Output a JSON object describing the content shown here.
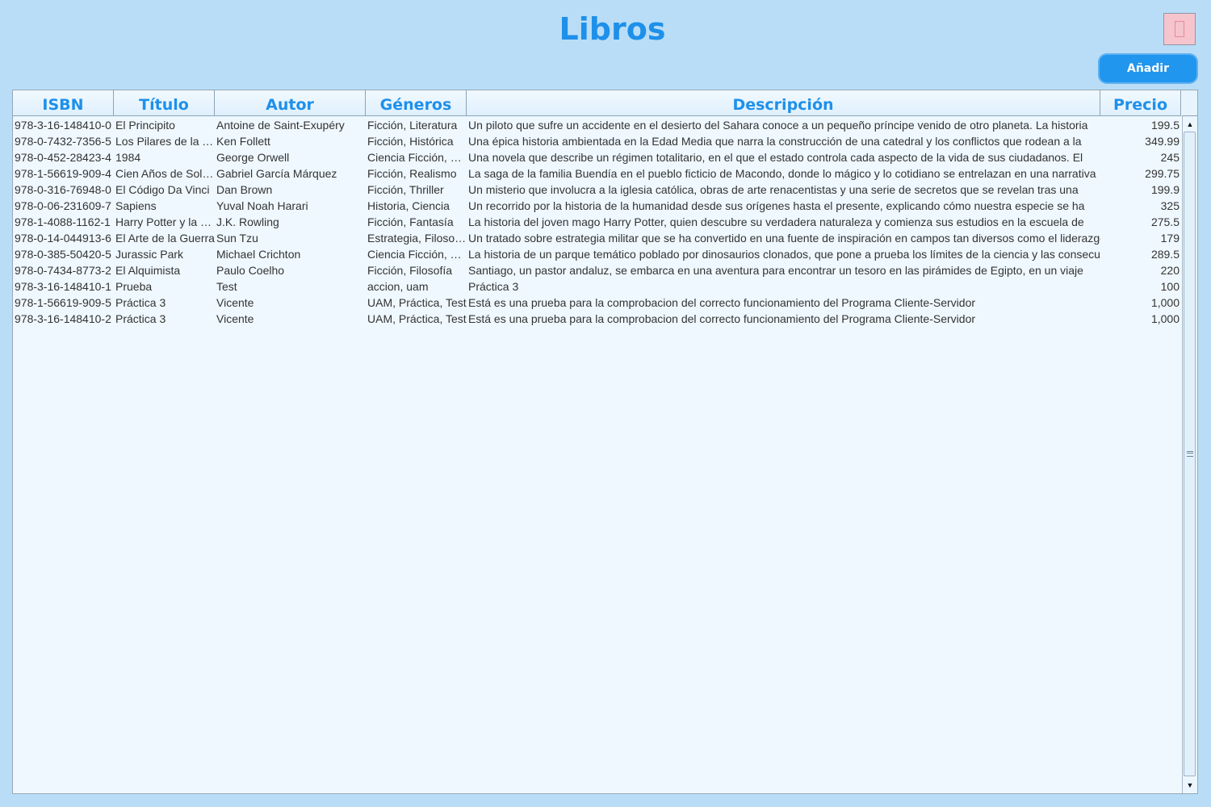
{
  "header": {
    "title": "Libros",
    "add_label": "Añadir",
    "close_icon": "close-icon"
  },
  "table": {
    "columns": [
      "ISBN",
      "Título",
      "Autor",
      "Géneros",
      "Descripción",
      "Precio"
    ],
    "rows": [
      [
        "978-3-16-148410-0",
        "El Principito",
        "Antoine de Saint-Exupéry",
        "Ficción,  Literatura",
        "Un piloto que sufre un accidente en el desierto del Sahara conoce a un pequeño príncipe venido de otro planeta. La historia",
        "199.5"
      ],
      [
        "978-0-7432-7356-5",
        "Los Pilares de la Tierra",
        "Ken Follett",
        "Ficción,  Histórica",
        "Una épica historia ambientada en la Edad Media que narra la construcción de una catedral y los conflictos que rodean a la",
        "349.99"
      ],
      [
        "978-0-452-28423-4",
        "1984",
        "George Orwell",
        "Ciencia Ficción,  Distopía",
        "Una novela que describe un régimen totalitario, en el que el estado controla cada aspecto de la vida de sus ciudadanos. El",
        "245"
      ],
      [
        "978-1-56619-909-4",
        "Cien Años de Soledad",
        "Gabriel García Márquez",
        "Ficción,  Realismo",
        "La saga de la familia Buendía en el pueblo ficticio de Macondo, donde lo mágico y lo cotidiano se entrelazan en una narrativa",
        "299.75"
      ],
      [
        "978-0-316-76948-0",
        "El Código Da Vinci",
        "Dan Brown",
        "Ficción,  Thriller",
        "Un misterio que involucra a la iglesia católica, obras de arte renacentistas y una serie de secretos que se revelan tras una",
        "199.9"
      ],
      [
        "978-0-06-231609-7",
        "Sapiens",
        "Yuval Noah Harari",
        "Historia,  Ciencia",
        "Un recorrido por la historia de la humanidad desde sus orígenes hasta el presente, explicando cómo nuestra especie se ha",
        "325"
      ],
      [
        "978-1-4088-1162-1",
        "Harry Potter y la Piedra Filosofal",
        "J.K. Rowling",
        "Ficción,  Fantasía",
        "La historia del joven mago Harry Potter, quien descubre su verdadera naturaleza y comienza sus estudios en la escuela de",
        "275.5"
      ],
      [
        "978-0-14-044913-6",
        "El Arte de la Guerra",
        "Sun Tzu",
        "Estrategia,  Filosofía",
        "Un tratado sobre estrategia militar que se ha convertido en una fuente de inspiración en campos tan diversos como el liderazgo",
        "179"
      ],
      [
        "978-0-385-50420-5",
        "Jurassic Park",
        "Michael Crichton",
        "Ciencia Ficción,  Thriller",
        "La historia de un parque temático poblado por dinosaurios clonados, que pone a prueba los límites de la ciencia y las consecuencias",
        "289.5"
      ],
      [
        "978-0-7434-8773-2",
        "El Alquimista",
        "Paulo Coelho",
        "Ficción,  Filosofía",
        "Santiago, un pastor andaluz, se embarca en una aventura para encontrar un tesoro en las pirámides de Egipto, en un viaje",
        "220"
      ],
      [
        "978-3-16-148410-1",
        "Prueba",
        "Test",
        "accion,  uam",
        "Práctica 3",
        "100"
      ],
      [
        "978-1-56619-909-5",
        "Práctica 3",
        "Vicente",
        "UAM,  Práctica,  Test",
        "Está es una prueba para la comprobacion del correcto funcionamiento del Programa Cliente-Servidor",
        "1,000"
      ],
      [
        "978-3-16-148410-2",
        "Práctica 3",
        "Vicente",
        "UAM,  Práctica,  Test",
        "Está es una prueba para la comprobacion del correcto funcionamiento del Programa Cliente-Servidor",
        "1,000"
      ]
    ]
  },
  "scrollbar": {
    "up_icon": "up-arrow-icon",
    "down_icon": "down-arrow-icon"
  }
}
